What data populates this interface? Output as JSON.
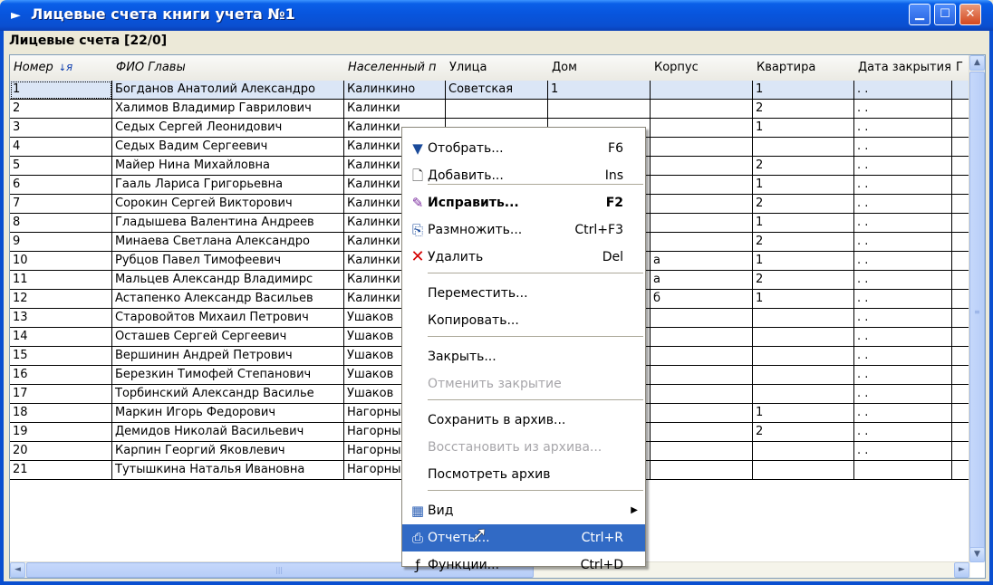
{
  "window": {
    "title": "Лицевые счета книги учета №1",
    "minimize": "▁",
    "maximize": "☐",
    "close": "✕"
  },
  "section_label": "Лицевые счета [22/0]",
  "columns": [
    "Номер",
    "ФИО Главы",
    "Населенный п",
    "Улица",
    "Дом",
    "Корпус",
    "Квартира",
    "Дата закрытия",
    "Г"
  ],
  "rows": [
    [
      "1",
      "Богданов Анатолий Александро",
      "Калинкино",
      "Советская",
      "1",
      "",
      "1",
      ". ."
    ],
    [
      "2",
      "Халимов Владимир Гаврилович",
      "Калинки",
      "",
      "",
      "",
      "2",
      ". ."
    ],
    [
      "3",
      "Седых Сергей Леонидович",
      "Калинки",
      "",
      "",
      "",
      "1",
      ". ."
    ],
    [
      "4",
      "Седых Вадим Сергеевич",
      "Калинки",
      "",
      "",
      "",
      "",
      ". ."
    ],
    [
      "5",
      "Майер Нина Михайловна",
      "Калинки",
      "",
      "",
      "",
      "2",
      ". ."
    ],
    [
      "6",
      "Гааль Лариса Григорьевна",
      "Калинки",
      "",
      "",
      "",
      "1",
      ". ."
    ],
    [
      "7",
      "Сорокин Сергей Викторович",
      "Калинки",
      "",
      "",
      "",
      "2",
      ". ."
    ],
    [
      "8",
      "Гладышева Валентина Андреев",
      "Калинки",
      "",
      "",
      "",
      "1",
      ". ."
    ],
    [
      "9",
      "Минаева Светлана Александро",
      "Калинки",
      "",
      "",
      "",
      "2",
      ". ."
    ],
    [
      "10",
      "Рубцов Павел Тимофеевич",
      "Калинки",
      "",
      "",
      "а",
      "1",
      ". ."
    ],
    [
      "11",
      "Мальцев Александр Владимирс",
      "Калинки",
      "",
      "",
      "а",
      "2",
      ". ."
    ],
    [
      "12",
      "Астапенко Александр Васильев",
      "Калинки",
      "",
      "",
      "б",
      "1",
      ". ."
    ],
    [
      "13",
      "Старовойтов Михаил Петрович",
      "Ушаков",
      "",
      "",
      "",
      "",
      ". ."
    ],
    [
      "14",
      "Осташев Сергей Сергеевич",
      "Ушаков",
      "",
      "",
      "",
      "",
      ". ."
    ],
    [
      "15",
      "Вершинин Андрей Петрович",
      "Ушаков",
      "",
      "",
      "",
      "",
      ". ."
    ],
    [
      "16",
      "Березкин Тимофей Степанович",
      "Ушаков",
      "",
      "",
      "",
      "",
      ". ."
    ],
    [
      "17",
      "Торбинский Александр Василье",
      "Ушаков",
      "",
      "",
      "",
      "",
      ". ."
    ],
    [
      "18",
      "Маркин Игорь Федорович",
      "Нагорны",
      "",
      "",
      "",
      "1",
      ". ."
    ],
    [
      "19",
      "Демидов Николай Васильевич",
      "Нагорны",
      "",
      "",
      "",
      "2",
      ". ."
    ],
    [
      "20",
      "Карпин Георгий Яковлевич",
      "Нагорны",
      "",
      "",
      "",
      "",
      ". ."
    ],
    [
      "21",
      "Тутышкина Наталья Ивановна",
      "Нагорны",
      "",
      "",
      "",
      "",
      ""
    ]
  ],
  "context_menu": [
    {
      "label": "Отобрать...",
      "shortcut": "F6",
      "icon": "filter-icon"
    },
    {
      "label": "Добавить...",
      "shortcut": "Ins",
      "icon": "new-document-icon"
    },
    {
      "label": "Исправить...",
      "shortcut": "F2",
      "icon": "edit-icon",
      "bold": true
    },
    {
      "label": "Размножить...",
      "shortcut": "Ctrl+F3",
      "icon": "copy-icon"
    },
    {
      "label": "Удалить",
      "shortcut": "Del",
      "icon": "delete-icon"
    },
    {
      "label": "Переместить...",
      "shortcut": ""
    },
    {
      "label": "Копировать...",
      "shortcut": ""
    },
    {
      "label": "Закрыть...",
      "shortcut": ""
    },
    {
      "label": "Отменить закрытие",
      "shortcut": "",
      "disabled": true
    },
    {
      "label": "Сохранить в архив...",
      "shortcut": ""
    },
    {
      "label": "Восстановить из архива...",
      "shortcut": "",
      "disabled": true
    },
    {
      "label": "Посмотреть архив",
      "shortcut": ""
    },
    {
      "label": "Вид",
      "shortcut": "",
      "icon": "view-icon",
      "submenu": true
    },
    {
      "label": "Отчеты...",
      "shortcut": "Ctrl+R",
      "icon": "printer-icon",
      "highlighted": true
    },
    {
      "label": "Функции...",
      "shortcut": "Ctrl+D",
      "icon": "function-icon"
    }
  ],
  "colors": {
    "title_bar": "#0a5fe8",
    "menu_highlight": "#316ac5",
    "selected_row": "#dbe6f6",
    "delete_icon": "#d40000"
  }
}
